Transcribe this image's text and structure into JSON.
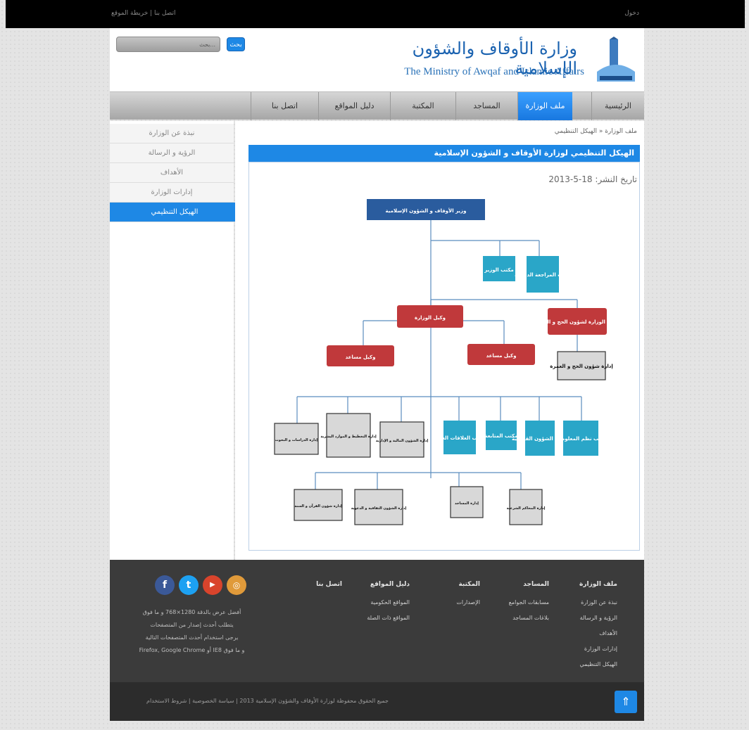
{
  "topbar": {
    "left_links": "اتصل بنا | خريطة الموقع",
    "right_text": "دخول"
  },
  "search": {
    "placeholder": "بحث...",
    "button": "بحث"
  },
  "logo": {
    "arabic": "وزارة الأوقاف والشؤون الإسلامية",
    "english": "The Ministry of Awqaf and Islamic Affairs"
  },
  "nav": {
    "items": [
      "الرئيسية",
      "ملف الوزارة",
      "المساجد",
      "المكتبة",
      "دليل المواقع",
      "اتصل بنا"
    ]
  },
  "sidebar": {
    "items": [
      "نبذة عن الوزارة",
      "الرؤية و الرسالة",
      "الأهداف",
      "إدارات الوزارة",
      "الهيكل التنظيمي"
    ]
  },
  "breadcrumb": "ملف الوزارة « الهيكل التنظيمي",
  "page_title": "الهيكل التنظيمي لوزارة الأوقاف و الشؤون الإسلامية",
  "pub_date": "تاريخ النشر: 18-5-2013",
  "org": {
    "minister": "وزير الأوقاف و الشؤون الإسلامية",
    "office_minister": "مكتب الوزير",
    "internal_audit": "مكتب المراجعة الداخلية",
    "undersecretary": "وكيل الوزارة",
    "undersecretary_hajj": "وكيل الوزارة لشؤون الحج و العمرة",
    "hajj_dept": "إدارة شؤون الحج و العمرة",
    "assistant_left": "وكيل مساعد",
    "assistant_right": "وكيل مساعد",
    "depts_row1": [
      "إدارة الدراسات و البحوث",
      "إدارة التخطيط و الموارد البشرية",
      "إدارة الشؤون المالية و الإدارية"
    ],
    "offices_row1": [
      "مكتب العلاقات العامة",
      "مكتب المتابعة",
      "مكتب الشؤون القانونية",
      "مكتب نظم المعلومات"
    ],
    "depts_row2": [
      "إدارة شؤون القرآن و السنة",
      "إدارة الشؤون الثقافية و الدعوية",
      "إدارة المساجد",
      "إدارة المحاكم الشرعية"
    ]
  },
  "footer": {
    "cols": [
      {
        "head": "ملف الوزارة",
        "links": [
          "نبذة عن الوزارة",
          "الرؤية و الرسالة",
          "الأهداف",
          "إدارات الوزارة",
          "الهيكل التنظيمي"
        ]
      },
      {
        "head": "المساجد",
        "links": [
          "مسابقات الجوامع",
          "بلاغات المساجد"
        ]
      },
      {
        "head": "المكتبة",
        "links": [
          "الإصدارات"
        ]
      },
      {
        "head": "دليل المواقع",
        "links": [
          "المواقع الحكومية",
          "المواقع ذات الصلة"
        ]
      },
      {
        "head": "اتصل بنا",
        "links": []
      }
    ],
    "notes": [
      "أفضل عرض بالدقة 1280×768 و ما فوق",
      "يتطلب أحدث إصدار من المتصفحات",
      "يرجى استخدام أحدث المتصفحات التالية",
      "Firefox, Google Chrome أو IE8 و ما فوق"
    ],
    "copyright": "جميع الحقوق محفوظة لوزارة الأوقاف والشؤون الإسلامية 2013 | سياسة الخصوصية | شروط الاستخدام"
  },
  "colors": {
    "accent": "#1e88e5",
    "red_box": "#c0393b",
    "teal_box": "#2aa6c8",
    "dark_blue": "#2a5c9e"
  }
}
